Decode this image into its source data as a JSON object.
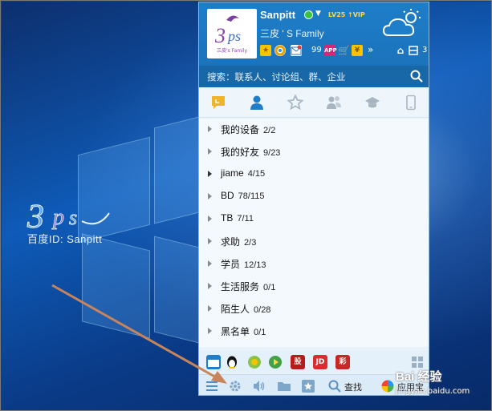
{
  "profile": {
    "nickname": "Sanpitt",
    "level_badge": "LV25",
    "vip_badge": "↑VIP",
    "signature": "三皮 ' S Family",
    "avatar_text": "三皮's Family",
    "mail_count": "99",
    "app_count": "3"
  },
  "search": {
    "placeholder": "搜索：联系人、讨论组、群、企业"
  },
  "tabs": [
    {
      "name": "recent"
    },
    {
      "name": "contacts"
    },
    {
      "name": "favorites"
    },
    {
      "name": "groups"
    },
    {
      "name": "qzone"
    },
    {
      "name": "devices"
    }
  ],
  "groups": [
    {
      "label": "我的设备",
      "count": "2/2"
    },
    {
      "label": "我的好友",
      "count": "9/23"
    },
    {
      "label": "jiame",
      "count": "4/15"
    },
    {
      "label": "BD",
      "count": "78/115"
    },
    {
      "label": "TB",
      "count": "7/11"
    },
    {
      "label": "求助",
      "count": "2/3"
    },
    {
      "label": "学员",
      "count": "12/13"
    },
    {
      "label": "生活服务",
      "count": "0/1"
    },
    {
      "label": "陌生人",
      "count": "0/28"
    },
    {
      "label": "黑名单",
      "count": "0/1"
    }
  ],
  "apps": [
    "股",
    "JD",
    "彩"
  ],
  "bottom": {
    "find_label": "查找",
    "appstore_label": "应用宝"
  },
  "desktop": {
    "watermark_text": "百度ID: Sanpitt"
  },
  "watermark": {
    "brand": "Bai 经验",
    "url": "jingyan.baidu.com"
  },
  "colors": {
    "header_blue": "#1e7ec9",
    "search_blue": "#1868a8",
    "arrow": "#c8845a"
  }
}
